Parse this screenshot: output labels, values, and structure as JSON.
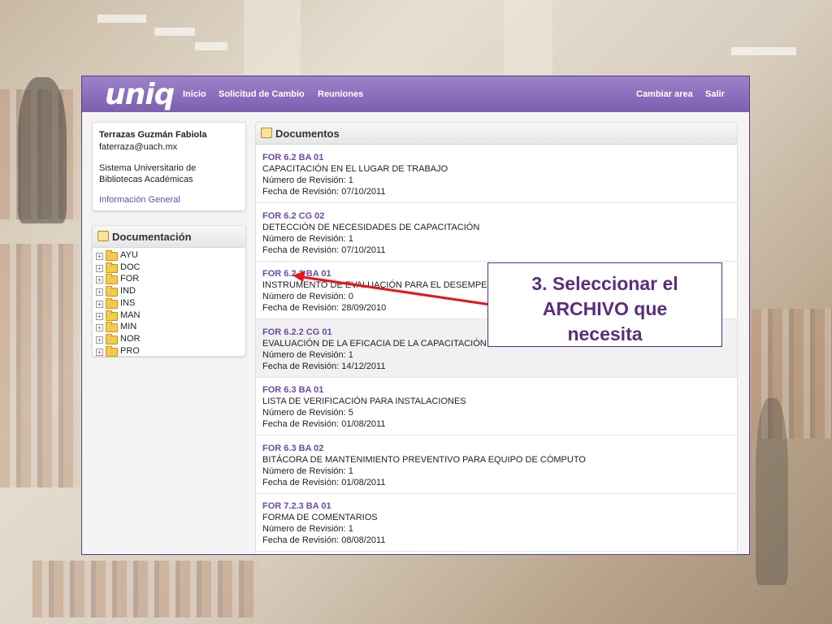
{
  "header": {
    "logo": "uniq",
    "nav_left": [
      "Inicio",
      "Solicitud de Cambio",
      "Reuniones"
    ],
    "nav_right": [
      "Cambiar area",
      "Salir"
    ]
  },
  "user": {
    "name": "Terrazas Guzmán Fabiola",
    "email": "faterraza@uach.mx",
    "org": "Sistema Universitario de Bibliotecas Académicas",
    "link": "Información General"
  },
  "documentation": {
    "title": "Documentación",
    "folders": [
      "AYU",
      "DOC",
      "FOR",
      "IND",
      "INS",
      "MAN",
      "MIN",
      "NOR",
      "PRO"
    ]
  },
  "documents": {
    "title": "Documentos",
    "revision_label": "Número de Revisión:",
    "date_label": "Fecha de Revisión:",
    "items": [
      {
        "code": "FOR 6.2 BA 01",
        "name": "CAPACITACIÓN EN EL LUGAR DE TRABAJO",
        "revision": "1",
        "date": "07/10/2011"
      },
      {
        "code": "FOR 6.2 CG 02",
        "name": "DETECCIÓN DE NECESIDADES DE CAPACITACIÓN",
        "revision": "1",
        "date": "07/10/2011"
      },
      {
        "code": "FOR 6.2.2 BA 01",
        "name": "INSTRUMENTO DE EVALUACIÓN PARA EL DESEMPEÑO",
        "revision": "0",
        "date": "28/09/2010"
      },
      {
        "code": "FOR 6.2.2 CG 01",
        "name": "EVALUACIÓN DE LA EFICACIA DE LA CAPACITACIÓN",
        "revision": "1",
        "date": "14/12/2011"
      },
      {
        "code": "FOR 6.3 BA 01",
        "name": "LISTA DE VERIFICACIÓN PARA INSTALACIONES",
        "revision": "5",
        "date": "01/08/2011"
      },
      {
        "code": "FOR 6.3 BA 02",
        "name": "BITÁCORA DE MANTENIMIENTO PREVENTIVO PARA EQUIPO DE CÓMPUTO",
        "revision": "1",
        "date": "01/08/2011"
      },
      {
        "code": "FOR 7.2.3 BA 01",
        "name": "FORMA DE COMENTARIOS",
        "revision": "1",
        "date": "08/08/2011"
      }
    ]
  },
  "callout": {
    "lines": [
      "3. Seleccionar el",
      "ARCHIVO que",
      "necesita"
    ]
  },
  "colors": {
    "header": "#7d5fb0",
    "link": "#6a4aa8",
    "callout_text": "#5a2d7e",
    "arrow": "#e8141b"
  }
}
